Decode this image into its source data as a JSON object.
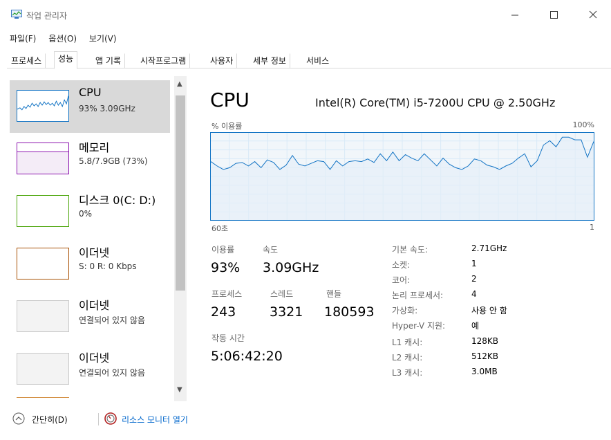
{
  "window": {
    "title": "작업 관리자"
  },
  "menu": [
    "파일(F)",
    "옵션(O)",
    "보기(V)"
  ],
  "tabs": [
    "프로세스",
    "성능",
    "앱 기록",
    "시작프로그램",
    "사용자",
    "세부 정보",
    "서비스"
  ],
  "active_tab": "성능",
  "resources": [
    {
      "title": "CPU",
      "subtitle": "93% 3.09GHz",
      "color": "#1173c4",
      "selected": true
    },
    {
      "title": "메모리",
      "subtitle": "5.8/7.9GB (73%)",
      "color": "#8b12ae"
    },
    {
      "title": "디스크 0(C: D:)",
      "subtitle": "0%",
      "color": "#4da60c"
    },
    {
      "title": "이더넷",
      "subtitle": "S: 0 R: 0 Kbps",
      "color": "#a74f01"
    },
    {
      "title": "이더넷",
      "subtitle": "연결되어 있지 않음",
      "color": "#b3b3b3"
    },
    {
      "title": "이더넷",
      "subtitle": "연결되어 있지 않음",
      "color": "#b3b3b3"
    }
  ],
  "cpu": {
    "heading": "CPU",
    "model": "Intel(R) Core(TM) i5-7200U CPU @ 2.50GHz",
    "usage_label": "% 이용률",
    "usage_max": "100%",
    "time_left": "60초",
    "time_right": "1",
    "stats": {
      "utilization_label": "이용률",
      "utilization": "93%",
      "speed_label": "속도",
      "speed": "3.09GHz",
      "processes_label": "프로세스",
      "processes": "243",
      "threads_label": "스레드",
      "threads": "3321",
      "handles_label": "핸들",
      "handles": "180593",
      "uptime_label": "작동 시간",
      "uptime": "5:06:42:20"
    },
    "specs": [
      {
        "label": "기본 속도:",
        "value": "2.71GHz"
      },
      {
        "label": "소켓:",
        "value": "1"
      },
      {
        "label": "코어:",
        "value": "2"
      },
      {
        "label": "논리 프로세서:",
        "value": "4"
      },
      {
        "label": "가상화:",
        "value": "사용 안 함"
      },
      {
        "label": "Hyper-V 지원:",
        "value": "예"
      },
      {
        "label": "L1 캐시:",
        "value": "128KB"
      },
      {
        "label": "L2 캐시:",
        "value": "512KB"
      },
      {
        "label": "L3 캐시:",
        "value": "3.0MB"
      }
    ]
  },
  "footer": {
    "fewer_details": "간단히(D)",
    "open_resource_monitor": "리소스 모니터 열기"
  },
  "chart_data": {
    "type": "line",
    "ylim": [
      0,
      100
    ],
    "x": [
      0,
      1,
      2,
      3,
      4,
      5,
      6,
      7,
      8,
      9,
      10,
      11,
      12,
      13,
      14,
      15,
      16,
      17,
      18,
      19,
      20,
      21,
      22,
      23,
      24,
      25,
      26,
      27,
      28,
      29,
      30,
      31,
      32,
      33,
      34,
      35,
      36,
      37,
      38,
      39,
      40,
      41,
      42,
      43,
      44,
      45,
      46,
      47,
      48,
      49,
      50,
      51,
      52,
      53,
      54,
      55,
      56,
      57,
      58,
      59,
      60
    ],
    "series": [
      {
        "values": [
          67,
          62,
          58,
          60,
          65,
          66,
          62,
          67,
          60,
          69,
          66,
          58,
          63,
          74,
          64,
          62,
          65,
          68,
          67,
          58,
          68,
          62,
          67,
          68,
          67,
          70,
          66,
          76,
          68,
          78,
          68,
          75,
          71,
          68,
          76,
          69,
          62,
          71,
          64,
          60,
          58,
          62,
          70,
          68,
          63,
          61,
          58,
          62,
          65,
          71,
          76,
          61,
          68,
          86,
          91,
          84,
          95,
          95,
          92,
          92,
          72,
          90
        ]
      }
    ]
  }
}
